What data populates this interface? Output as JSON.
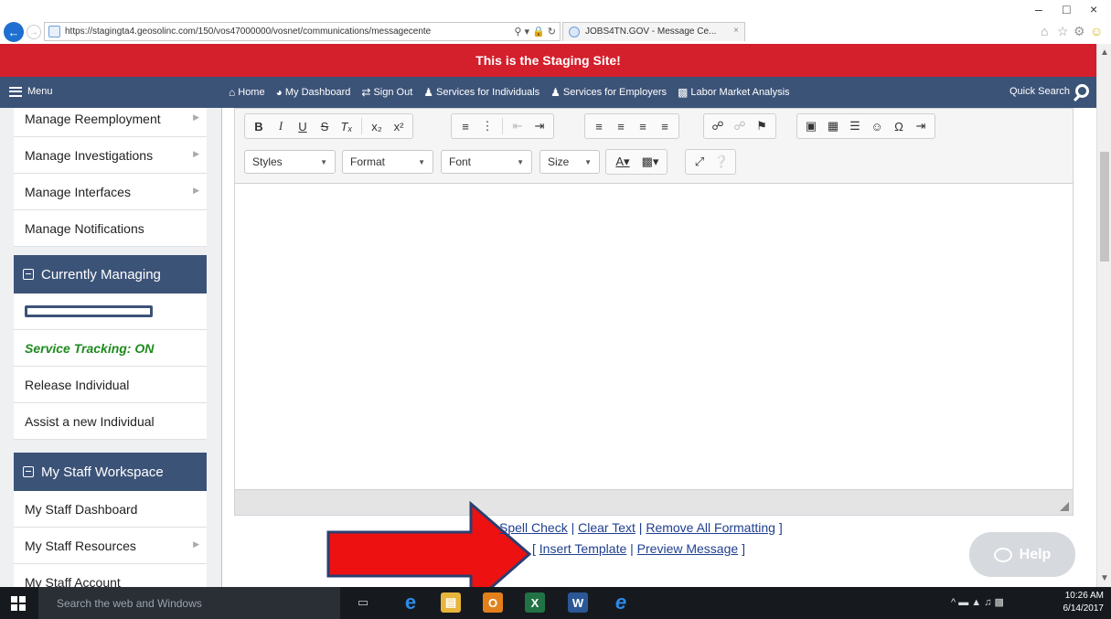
{
  "browser": {
    "url": "https://stagingta4.geosolinc.com/150/vos47000000/vosnet/communications/messagecente",
    "url_host_bold": "geosolinc.com",
    "tab_title": "JOBS4TN.GOV - Message Ce...",
    "window_controls": [
      "–",
      "□",
      "×"
    ]
  },
  "banner": {
    "text": "This is the Staging Site!"
  },
  "nav": {
    "menu_label": "Menu",
    "links": [
      {
        "label": "Home",
        "icon": "home-icon"
      },
      {
        "label": "My Dashboard",
        "icon": "dashboard-icon"
      },
      {
        "label": "Sign Out",
        "icon": "sign-out-icon"
      },
      {
        "label": "Services for Individuals",
        "icon": "individual-icon"
      },
      {
        "label": "Services for Employers",
        "icon": "employers-icon"
      },
      {
        "label": "Labor Market Analysis",
        "icon": "chart-icon"
      }
    ],
    "quick_search_label": "Quick Search"
  },
  "sidebar": {
    "manage_items": [
      {
        "label": "Manage Reemployment",
        "has_submenu": true
      },
      {
        "label": "Manage Investigations",
        "has_submenu": true
      },
      {
        "label": "Manage Interfaces",
        "has_submenu": true
      },
      {
        "label": "Manage Notifications",
        "has_submenu": false
      }
    ],
    "currently_managing": {
      "header": "Currently Managing",
      "service_tracking": "Service Tracking: ON",
      "items": [
        "Release Individual",
        "Assist a new Individual"
      ]
    },
    "staff_workspace": {
      "header": "My Staff Workspace",
      "items": [
        {
          "label": "My Staff Dashboard",
          "has_submenu": false
        },
        {
          "label": "My Staff Resources",
          "has_submenu": true
        },
        {
          "label": "My Staff Account",
          "has_submenu": false
        }
      ]
    }
  },
  "editor": {
    "dropdowns": [
      "Styles",
      "Format",
      "Font",
      "Size"
    ]
  },
  "links": {
    "row1": {
      "open": "[",
      "spell_check": "Spell Check",
      "sep": "|",
      "clear_text": "Clear Text",
      "remove_formatting": "Remove All Formatting",
      "close": "]"
    },
    "row2": {
      "open": "[",
      "insert_template": "Insert Template",
      "sep": "|",
      "preview_message": "Preview Message",
      "close": "]"
    }
  },
  "help": {
    "label": "Help"
  },
  "taskbar": {
    "search_placeholder": "Search the web and Windows",
    "time": "10:26 AM",
    "date": "6/14/2017"
  },
  "colors": {
    "banner": "#d41f2c",
    "nav": "#3c5378",
    "annotation_arrow": "#ee1111",
    "link": "#1f3f8f",
    "tracking": "#1e8a1e"
  }
}
